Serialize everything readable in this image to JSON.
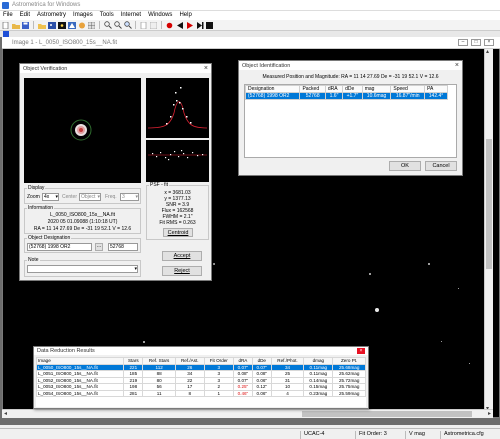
{
  "app": {
    "title": "Astrometrica for Windows",
    "menu": [
      "File",
      "Edit",
      "Astrometry",
      "Images",
      "Tools",
      "Internet",
      "Windows",
      "Help"
    ],
    "toolbar_icons": [
      "new-icon",
      "open-icon",
      "save-icon",
      "folder-icon",
      "image-icon",
      "star-icon",
      "blink-icon",
      "brightness-icon",
      "grid-icon",
      "zoom-in-icon",
      "zoom-out-icon",
      "magnifier-icon",
      "page-icon",
      "info-icon",
      "record-icon",
      "prev-icon",
      "play-icon",
      "next-icon",
      "stop-icon"
    ]
  },
  "image_window": {
    "title": "Image 1 - L_0050_ISO800_15s__NA.fit"
  },
  "status_bar": {
    "catalog": "UCAC-4",
    "fit_order": "Fit Order: 3",
    "mag_band": "V mag",
    "config": "Astrometrica.cfg"
  },
  "object_verification": {
    "title": "Object Verification",
    "display_label": "Display",
    "zoom_label": "Zoom",
    "zoom_value": "4x",
    "center_label": "Center",
    "center_value": "Object",
    "freq_label": "Freq.",
    "freq_value": "3",
    "info_label": "Information",
    "info_filename": "L_0050_ISO800_15s__NA.fit",
    "info_datetime": "2020 05 01.09088 (1:10:18 UT)",
    "info_coords": "RA = 11 14 27.69   De = -31 19 52.1   V = 12.6",
    "designation_label": "Object Designation",
    "designation_value": "(52768) 1998 OR2",
    "designation_number": "52768",
    "note_label": "Note",
    "psf_label": "PSF - fit",
    "psf": {
      "x": "x = 3681.03",
      "y": "y = 1377.13",
      "snr": "SNR = 3.9",
      "flux": "Flux = 162568",
      "fwhm": "FWHM = 2.1\"",
      "fit_rms": "Fit RMS = 0.263"
    },
    "centroid_btn": "Centroid",
    "accept_btn": "Accept",
    "reject_btn": "Reject"
  },
  "object_identification": {
    "title": "Object Identification",
    "header": "Measured Position and Magnitude:  RA = 11 14 27.69   De = -31 19 52.1   V = 12.6",
    "columns": [
      "Designation",
      "Packed",
      "dRA",
      "dDe",
      "mag",
      "Speed",
      "PA"
    ],
    "rows": [
      [
        "(52768) 1998 OR2",
        "52768",
        "1.6\"",
        "+1.7\"",
        "10.6mag",
        "16.87\"/min",
        "142.4°"
      ]
    ],
    "ok_btn": "OK",
    "cancel_btn": "Cancel"
  },
  "data_reduction": {
    "title": "Data Reduction Results",
    "columns": [
      "Image",
      "Stars",
      "Ref. Stars",
      "Ref./Ast.",
      "Fit Order",
      "dRA",
      "dDe",
      "Ref./Phot.",
      "dmag",
      "Zero Pt."
    ],
    "rows": [
      [
        "L_0050_ISO800_15s__NA.fit",
        "221",
        "112",
        "26",
        "3",
        "0.07\"",
        "0.07\"",
        "34",
        "0.11mag",
        "25.68mag"
      ],
      [
        "L_0051_ISO800_15s__NA.fit",
        "185",
        "88",
        "34",
        "3",
        "0.08\"",
        "0.08\"",
        "25",
        "0.11mag",
        "25.62mag"
      ],
      [
        "L_0052_ISO800_15s__NA.fit",
        "219",
        "80",
        "22",
        "3",
        "0.07\"",
        "0.06\"",
        "31",
        "0.14mag",
        "25.72mag"
      ],
      [
        "L_0053_ISO800_15s__NA.fit",
        "198",
        "56",
        "17",
        "2",
        "0.25\"",
        "0.12\"",
        "10",
        "0.15mag",
        "25.75mag"
      ],
      [
        "L_0054_ISO800_15s__NA.fit",
        "281",
        "11",
        "8",
        "1",
        "0.46\"",
        "0.06\"",
        "4",
        "0.23mag",
        "25.59mag"
      ]
    ],
    "red_cells": [
      [
        3,
        5
      ],
      [
        4,
        5
      ]
    ]
  },
  "colors": {
    "selection": "#0078d7",
    "warning": "#d11111",
    "record": "#d40000"
  }
}
